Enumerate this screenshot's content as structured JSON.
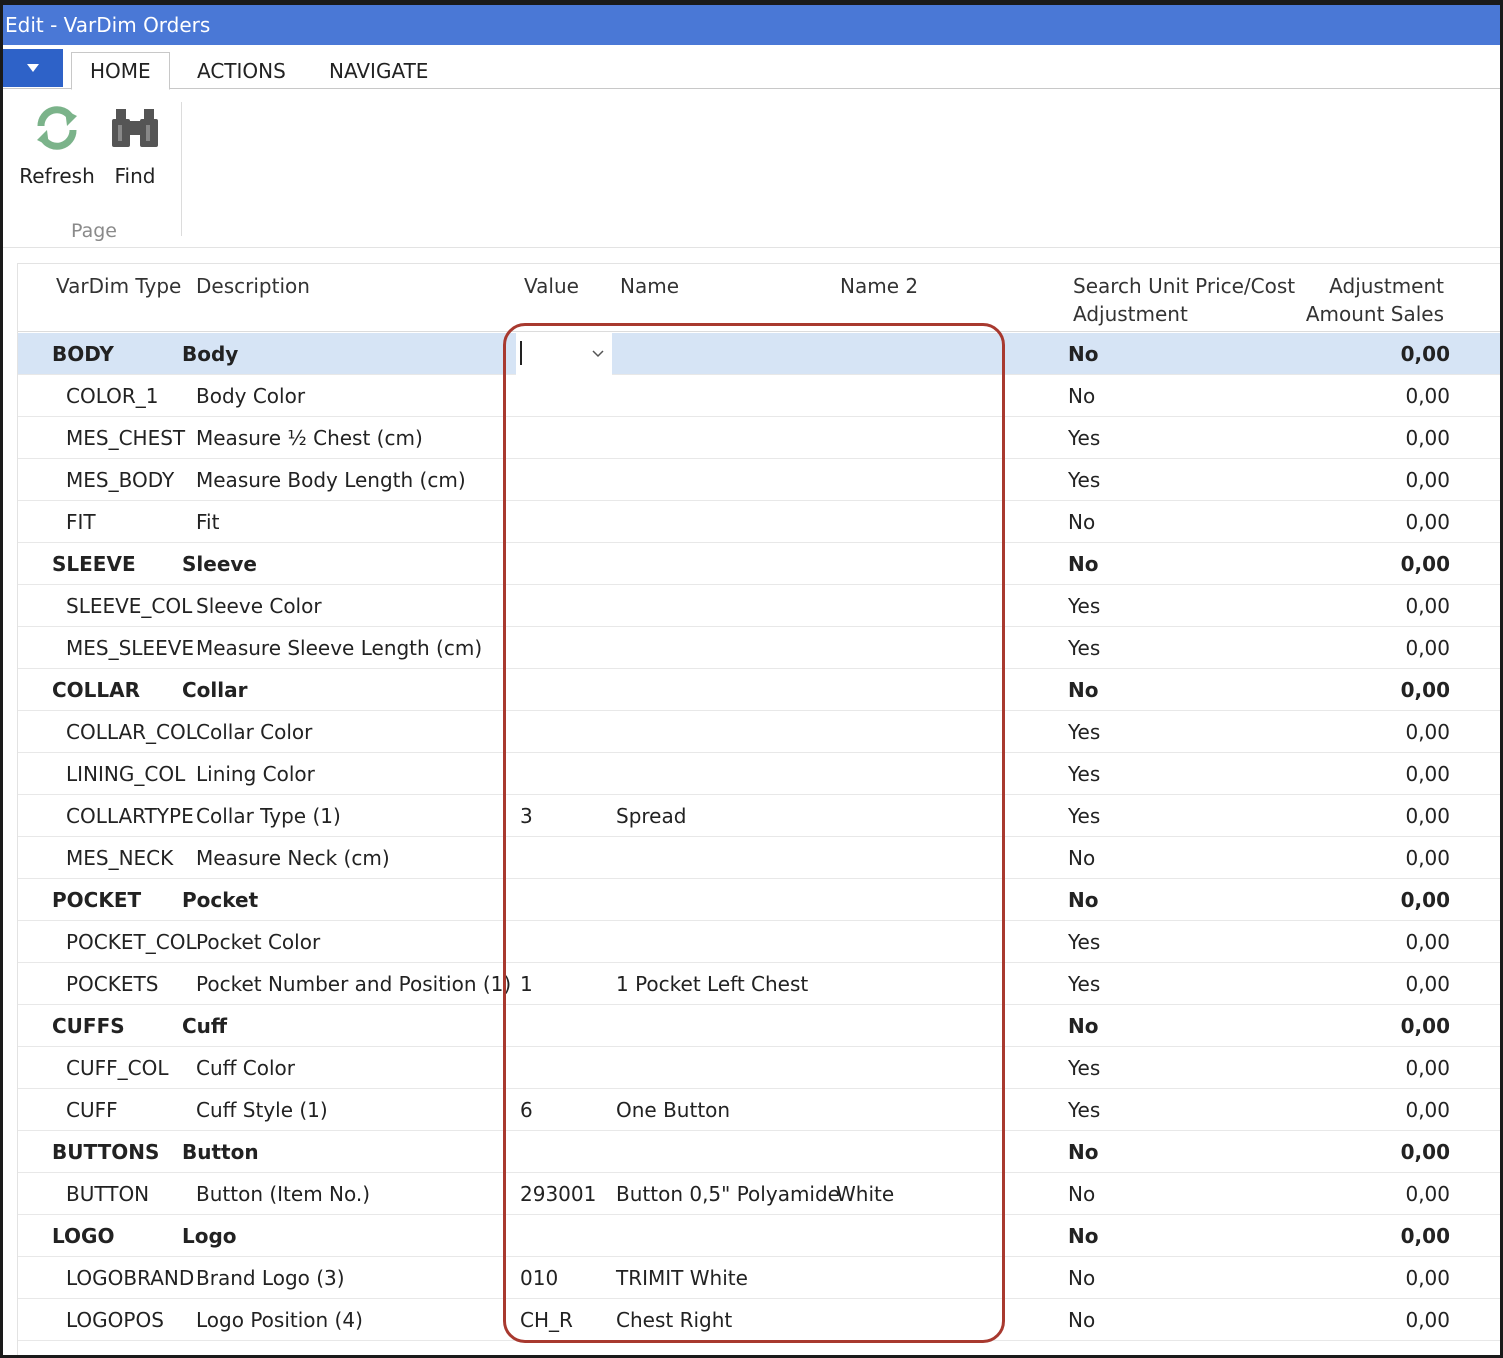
{
  "window": {
    "title": "Edit - VarDim Orders"
  },
  "ribbon": {
    "tabs": [
      {
        "label": "HOME"
      },
      {
        "label": "ACTIONS"
      },
      {
        "label": "NAVIGATE"
      }
    ],
    "buttons": [
      {
        "label": "Refresh",
        "icon": "refresh-icon"
      },
      {
        "label": "Find",
        "icon": "binoculars-icon"
      }
    ],
    "group_label": "Page"
  },
  "grid": {
    "headers": {
      "type": "VarDim Type",
      "description": "Description",
      "value": "Value",
      "name": "Name",
      "name2": "Name 2",
      "search_line1": "Search Unit Price/Cost",
      "search_line2": "Adjustment",
      "adj_line1": "Adjustment",
      "adj_line2": "Amount Sales"
    },
    "rows": [
      {
        "type": "BODY",
        "description": "Body",
        "value": "",
        "name": "",
        "name2": "",
        "search": "No",
        "adj": "0,00",
        "group": true,
        "selected": true
      },
      {
        "type": "COLOR_1",
        "description": "Body Color",
        "value": "",
        "name": "",
        "name2": "",
        "search": "No",
        "adj": "0,00"
      },
      {
        "type": "MES_CHEST",
        "description": "Measure ½ Chest (cm)",
        "value": "",
        "name": "",
        "name2": "",
        "search": "Yes",
        "adj": "0,00"
      },
      {
        "type": "MES_BODY",
        "description": "Measure Body Length (cm)",
        "value": "",
        "name": "",
        "name2": "",
        "search": "Yes",
        "adj": "0,00"
      },
      {
        "type": "FIT",
        "description": "Fit",
        "value": "",
        "name": "",
        "name2": "",
        "search": "No",
        "adj": "0,00"
      },
      {
        "type": "SLEEVE",
        "description": "Sleeve",
        "value": "",
        "name": "",
        "name2": "",
        "search": "No",
        "adj": "0,00",
        "group": true
      },
      {
        "type": "SLEEVE_COL",
        "description": "Sleeve Color",
        "value": "",
        "name": "",
        "name2": "",
        "search": "Yes",
        "adj": "0,00"
      },
      {
        "type": "MES_SLEEVE",
        "description": "Measure Sleeve Length (cm)",
        "value": "",
        "name": "",
        "name2": "",
        "search": "Yes",
        "adj": "0,00"
      },
      {
        "type": "COLLAR",
        "description": "Collar",
        "value": "",
        "name": "",
        "name2": "",
        "search": "No",
        "adj": "0,00",
        "group": true
      },
      {
        "type": "COLLAR_COL",
        "description": "Collar Color",
        "value": "",
        "name": "",
        "name2": "",
        "search": "Yes",
        "adj": "0,00"
      },
      {
        "type": "LINING_COL",
        "description": "Lining Color",
        "value": "",
        "name": "",
        "name2": "",
        "search": "Yes",
        "adj": "0,00"
      },
      {
        "type": "COLLARTYPE",
        "description": "Collar Type (1)",
        "value": "3",
        "name": "Spread",
        "name2": "",
        "search": "Yes",
        "adj": "0,00"
      },
      {
        "type": "MES_NECK",
        "description": "Measure Neck (cm)",
        "value": "",
        "name": "",
        "name2": "",
        "search": "No",
        "adj": "0,00"
      },
      {
        "type": "POCKET",
        "description": "Pocket",
        "value": "",
        "name": "",
        "name2": "",
        "search": "No",
        "adj": "0,00",
        "group": true
      },
      {
        "type": "POCKET_COL",
        "description": "Pocket Color",
        "value": "",
        "name": "",
        "name2": "",
        "search": "Yes",
        "adj": "0,00"
      },
      {
        "type": "POCKETS",
        "description": "Pocket Number and Position (1)",
        "value": "1",
        "name": "1 Pocket Left Chest",
        "name2": "",
        "search": "Yes",
        "adj": "0,00"
      },
      {
        "type": "CUFFS",
        "description": "Cuff",
        "value": "",
        "name": "",
        "name2": "",
        "search": "No",
        "adj": "0,00",
        "group": true
      },
      {
        "type": "CUFF_COL",
        "description": "Cuff Color",
        "value": "",
        "name": "",
        "name2": "",
        "search": "Yes",
        "adj": "0,00"
      },
      {
        "type": "CUFF",
        "description": "Cuff Style (1)",
        "value": "6",
        "name": "One Button",
        "name2": "",
        "search": "Yes",
        "adj": "0,00"
      },
      {
        "type": "BUTTONS",
        "description": "Button",
        "value": "",
        "name": "",
        "name2": "",
        "search": "No",
        "adj": "0,00",
        "group": true
      },
      {
        "type": "BUTTON",
        "description": "Button (Item No.)",
        "value": "293001",
        "name": "Button 0,5\" Polyamide",
        "name2": "White",
        "search": "No",
        "adj": "0,00"
      },
      {
        "type": "LOGO",
        "description": "Logo",
        "value": "",
        "name": "",
        "name2": "",
        "search": "No",
        "adj": "0,00",
        "group": true
      },
      {
        "type": "LOGOBRAND",
        "description": "Brand Logo (3)",
        "value": "010",
        "name": "TRIMIT White",
        "name2": "",
        "search": "No",
        "adj": "0,00"
      },
      {
        "type": "LOGOPOS",
        "description": "Logo Position (4)",
        "value": "CH_R",
        "name": "Chest Right",
        "name2": "",
        "search": "No",
        "adj": "0,00"
      }
    ]
  },
  "colors": {
    "titlebar": "#4a78d6",
    "app_menu": "#2e62c8",
    "selected_row": "#d6e4f5",
    "highlight_border": "#a8392f"
  }
}
